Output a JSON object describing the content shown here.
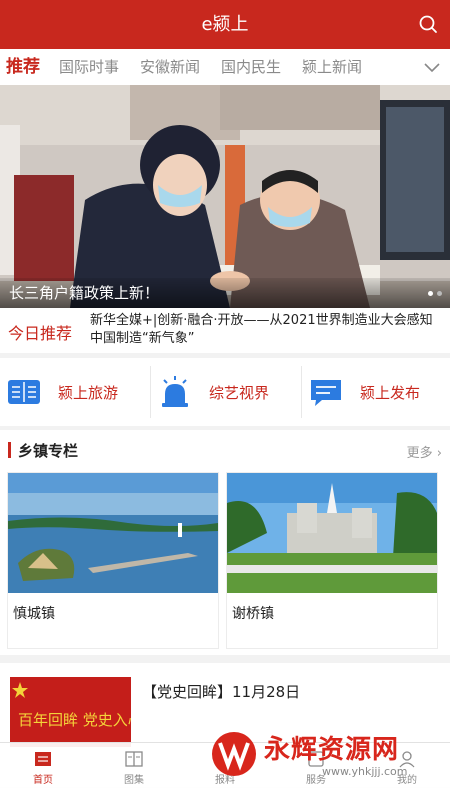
{
  "header": {
    "title": "e颍上",
    "search_icon": "search-icon",
    "accent": "#c8281e"
  },
  "tabs": [
    {
      "label": "推荐",
      "active": true
    },
    {
      "label": "国际时事",
      "active": false
    },
    {
      "label": "安徽新闻",
      "active": false
    },
    {
      "label": "国内民生",
      "active": false
    },
    {
      "label": "颍上新闻",
      "active": false
    }
  ],
  "banner": {
    "caption": "长三角户籍政策上新！",
    "slide_count": 2,
    "active_slide": 1
  },
  "today": {
    "label": "今日推荐",
    "headline": "新华全媒+|创新·融合·开放——从2021世界制造业大会感知中国制造“新气象”"
  },
  "quick_links": [
    {
      "label": "颍上旅游",
      "icon": "book-icon"
    },
    {
      "label": "综艺视界",
      "icon": "siren-icon"
    },
    {
      "label": "颍上发布",
      "icon": "chat-icon"
    }
  ],
  "towns": {
    "title": "乡镇专栏",
    "more": "更多",
    "items": [
      {
        "name": "慎城镇"
      },
      {
        "name": "谢桥镇"
      }
    ]
  },
  "news": {
    "title": "【党史回眸】11月28日",
    "thumb_text": "百年回眸 党史入心"
  },
  "bottom_nav": [
    {
      "label": "首页",
      "active": true
    },
    {
      "label": "图集",
      "active": false
    },
    {
      "label": "报料",
      "active": false
    },
    {
      "label": "服务",
      "active": false
    },
    {
      "label": "我的",
      "active": false
    }
  ],
  "watermark": {
    "text": "永辉资源网",
    "url": "www.yhkjjj.com"
  }
}
